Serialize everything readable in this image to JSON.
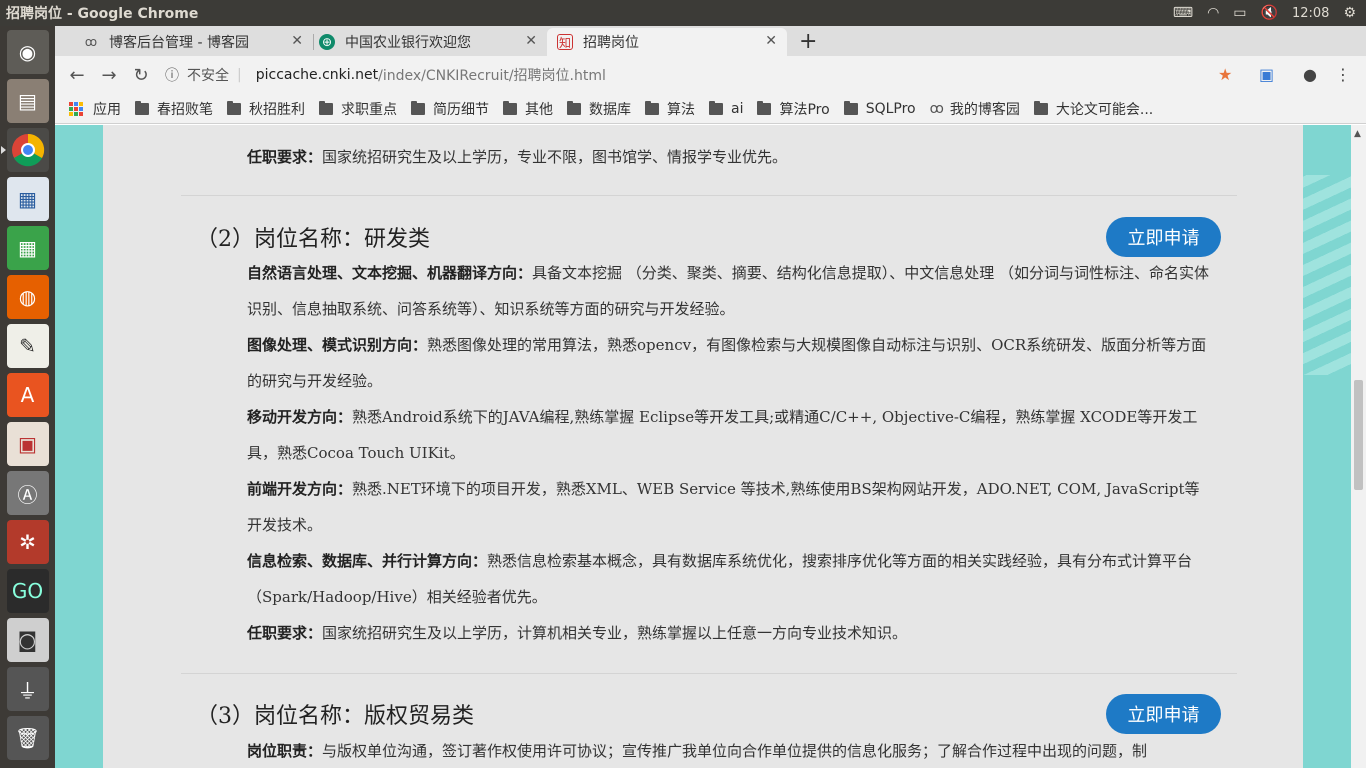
{
  "system": {
    "window_title": "招聘岗位 - Google Chrome",
    "clock": "12:08"
  },
  "tabs": [
    {
      "label": "博客后台管理 - 博客园",
      "favicon": "cnblogs-icon"
    },
    {
      "label": "中国农业银行欢迎您",
      "favicon": "abc-bank-icon"
    },
    {
      "label": "招聘岗位",
      "favicon": "cnki-icon"
    }
  ],
  "omnibox": {
    "security": "不安全",
    "host": "piccache.cnki.net",
    "path": "/index/CNKIRecruit/招聘岗位.html"
  },
  "bookmarks": [
    "应用",
    "春招败笔",
    "秋招胜利",
    "求职重点",
    "简历细节",
    "其他",
    "数据库",
    "算法",
    "ai",
    "算法Pro",
    "SQLPro",
    "我的博客园",
    "大论文可能会..."
  ],
  "page": {
    "prev_requirement": {
      "label": "任职要求：",
      "text": "国家统招研究生及以上学历，专业不限，图书馆学、情报学专业优先。"
    },
    "job2": {
      "title": "（2）岗位名称：研发类",
      "apply": "立即申请",
      "items": [
        {
          "label": "自然语言处理、文本挖掘、机器翻译方向：",
          "text": "具备文本挖掘 （分类、聚类、摘要、结构化信息提取）、中文信息处理 （如分词与词性标注、命名实体识别、信息抽取系统、问答系统等）、知识系统等方面的研究与开发经验。"
        },
        {
          "label": "图像处理、模式识别方向：",
          "text": "熟悉图像处理的常用算法，熟悉opencv，有图像检索与大规模图像自动标注与识别、OCR系统研发、版面分析等方面的研究与开发经验。"
        },
        {
          "label": "移动开发方向：",
          "text": "熟悉Android系统下的JAVA编程,熟练掌握 Eclipse等开发工具;或精通C/C++, Objective-C编程，熟练掌握 XCODE等开发工具，熟悉Cocoa Touch UIKit。"
        },
        {
          "label": "前端开发方向：",
          "text": "熟悉.NET环境下的项目开发，熟悉XML、WEB Service 等技术,熟练使用BS架构网站开发，ADO.NET, COM, JavaScript等开发技术。"
        },
        {
          "label": "信息检索、数据库、并行计算方向：",
          "text": "熟悉信息检索基本概念，具有数据库系统优化，搜索排序优化等方面的相关实践经验，具有分布式计算平台（Spark/Hadoop/Hive）相关经验者优先。"
        },
        {
          "label": "任职要求：",
          "text": "国家统招研究生及以上学历，计算机相关专业，熟练掌握以上任意一方向专业技术知识。"
        }
      ]
    },
    "job3": {
      "title": "（3）岗位名称：版权贸易类",
      "apply": "立即申请",
      "duty": {
        "label": "岗位职责：",
        "text": "与版权单位沟通，签订著作权使用许可协议；宣传推广我单位向合作单位提供的信息化服务；了解合作过程中出现的问题，制"
      }
    }
  }
}
